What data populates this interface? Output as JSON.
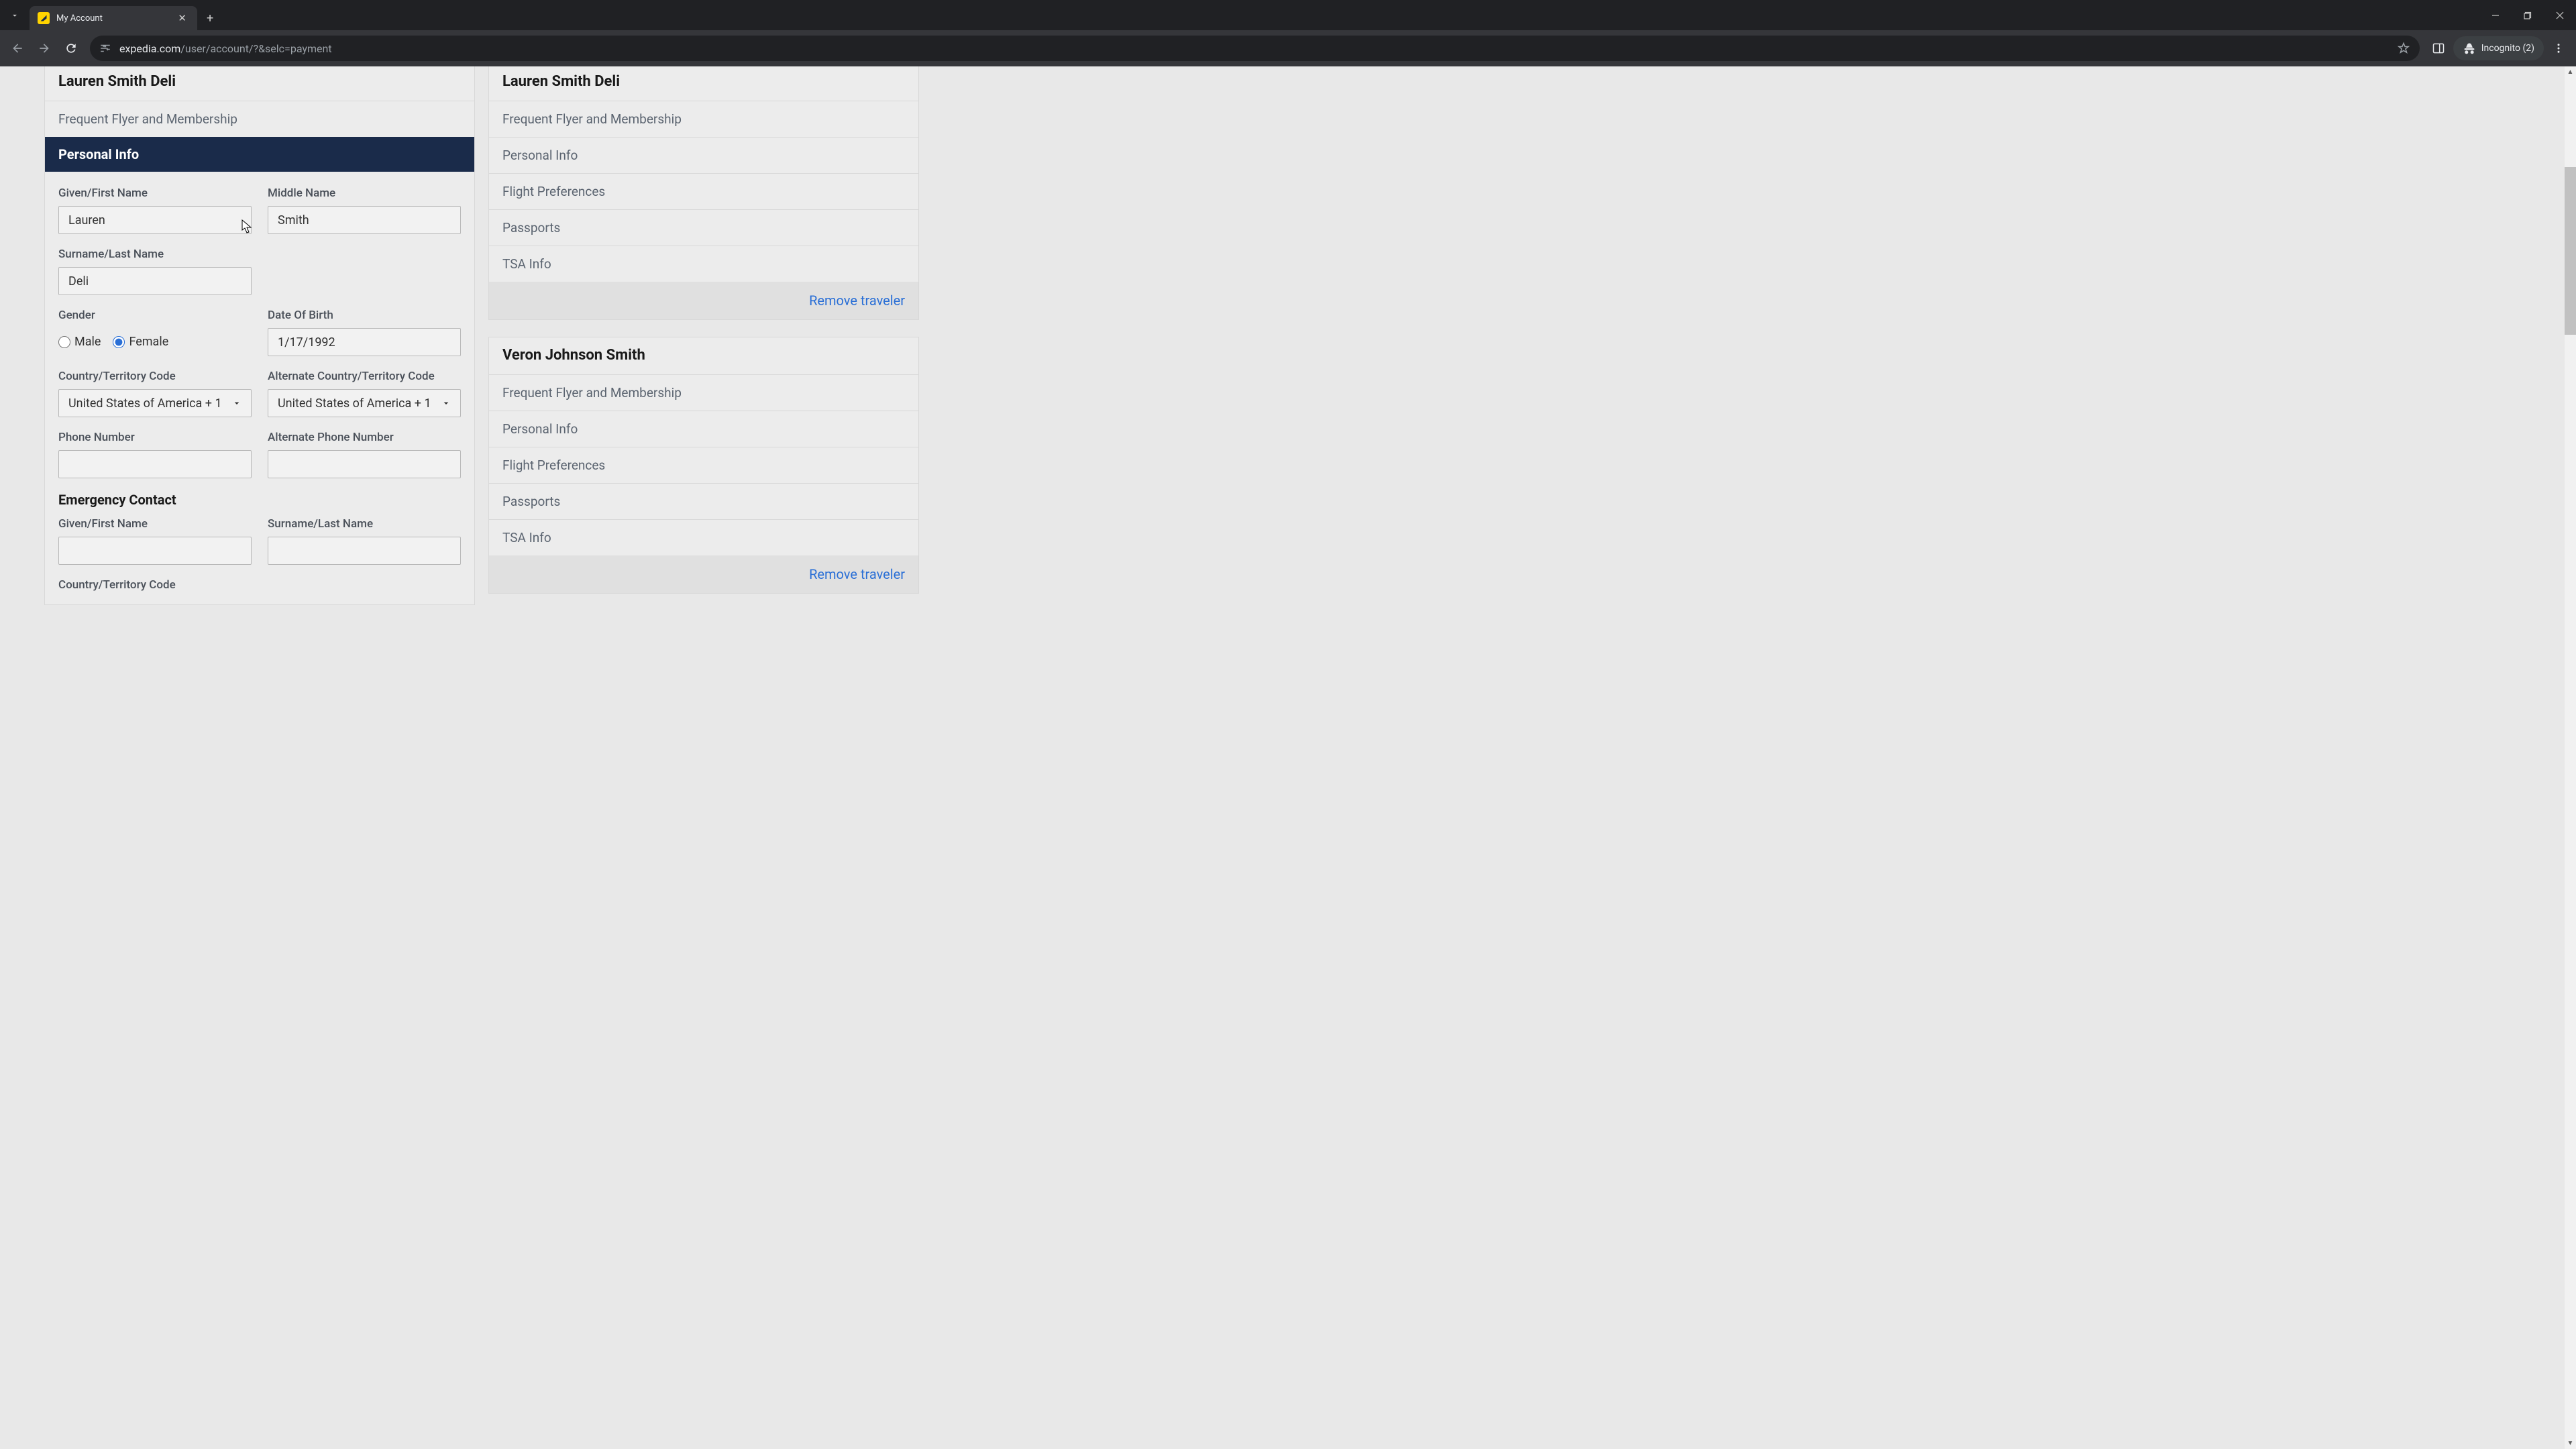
{
  "browser": {
    "tab_title": "My Account",
    "url_domain": "expedia.com",
    "url_path": "/user/account/?&selc=payment",
    "incognito_label": "Incognito (2)"
  },
  "left_card": {
    "title": "Lauren Smith Deli",
    "item_ffm": "Frequent Flyer and Membership",
    "active_section": "Personal Info"
  },
  "form": {
    "first_name_label": "Given/First Name",
    "first_name": "Lauren",
    "middle_name_label": "Middle Name",
    "middle_name": "Smith",
    "last_name_label": "Surname/Last Name",
    "last_name": "Deli",
    "gender_label": "Gender",
    "gender_male": "Male",
    "gender_female": "Female",
    "dob_label": "Date Of Birth",
    "dob": "1/17/1992",
    "country_code_label": "Country/Territory Code",
    "country_code": "United States of America + 1",
    "alt_country_code_label": "Alternate Country/Territory Code",
    "alt_country_code": "United States of America + 1",
    "phone_label": "Phone Number",
    "phone": "",
    "alt_phone_label": "Alternate Phone Number",
    "alt_phone": "",
    "emergency_title": "Emergency Contact",
    "em_first_label": "Given/First Name",
    "em_first": "",
    "em_last_label": "Surname/Last Name",
    "em_last": "",
    "em_country_label": "Country/Territory Code"
  },
  "right_cards": [
    {
      "title": "Lauren Smith Deli",
      "items": [
        "Frequent Flyer and Membership",
        "Personal Info",
        "Flight Preferences",
        "Passports",
        "TSA Info"
      ],
      "action": "Remove traveler"
    },
    {
      "title": "Veron Johnson Smith",
      "items": [
        "Frequent Flyer and Membership",
        "Personal Info",
        "Flight Preferences",
        "Passports",
        "TSA Info"
      ],
      "action": "Remove traveler"
    }
  ],
  "colors": {
    "accent_dark": "#1a2b4a",
    "link": "#2a6fd6"
  }
}
